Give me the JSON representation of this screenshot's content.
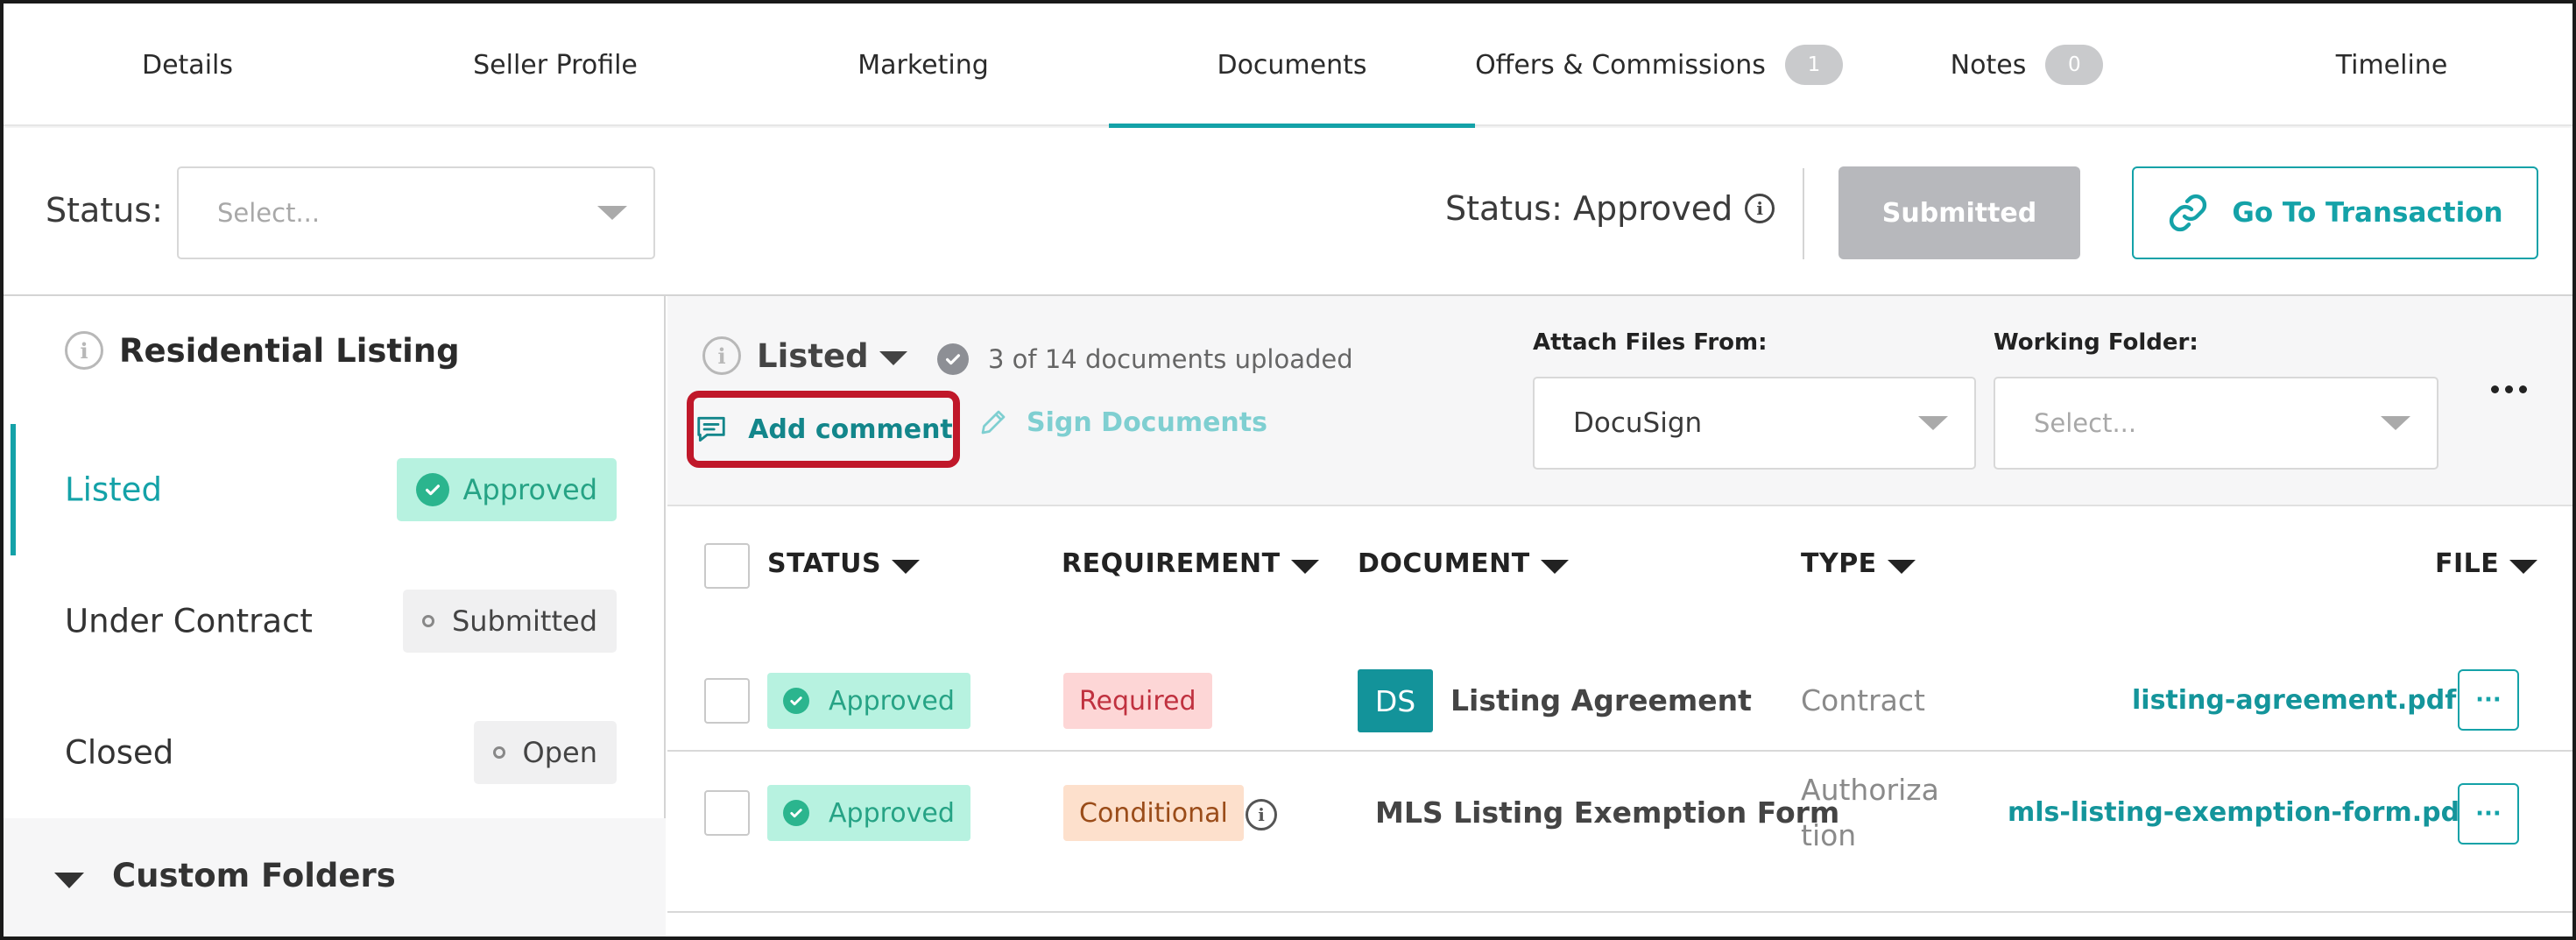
{
  "tabs": [
    {
      "label": "Details"
    },
    {
      "label": "Seller Profile"
    },
    {
      "label": "Marketing"
    },
    {
      "label": "Documents",
      "active": true
    },
    {
      "label": "Offers & Commissions",
      "count": "1"
    },
    {
      "label": "Notes",
      "count": "0"
    },
    {
      "label": "Timeline"
    }
  ],
  "status_bar": {
    "label": "Status:",
    "select_placeholder": "Select...",
    "current_status": "Status: Approved",
    "submitted_label": "Submitted",
    "goto_label": "Go To Transaction"
  },
  "sidebar": {
    "title": "Residential Listing",
    "items": [
      {
        "name": "Listed",
        "status": "Approved"
      },
      {
        "name": "Under Contract",
        "status": "Submitted"
      },
      {
        "name": "Closed",
        "status": "Open"
      }
    ],
    "custom_folders_label": "Custom Folders"
  },
  "toolbar": {
    "stage_label": "Listed",
    "uploaded_text": "3 of 14 documents uploaded",
    "add_comment_label": "Add comment",
    "sign_documents_label": "Sign Documents",
    "attach_files_label": "Attach Files From:",
    "attach_files_value": "DocuSign",
    "working_folder_label": "Working Folder:",
    "working_folder_placeholder": "Select..."
  },
  "table": {
    "headers": {
      "status": "STATUS",
      "requirement": "REQUIREMENT",
      "document": "DOCUMENT",
      "type": "TYPE",
      "file": "FILE"
    },
    "rows": [
      {
        "status": "Approved",
        "requirement": "Required",
        "doc_badge": "DS",
        "document": "Listing Agreement",
        "type": "Contract",
        "file": "listing-agreement.pdf",
        "action": "···"
      },
      {
        "status": "Approved",
        "requirement": "Conditional",
        "document": "MLS Listing Exemption Form",
        "type_line1": "Authoriza",
        "type_line2": "tion",
        "file": "mls-listing-exemption-form.pdf",
        "action": "···"
      }
    ]
  },
  "colors": {
    "accent": "#14a2a8",
    "approved_bg": "#b7f2e0",
    "highlight_box": "#c0182a"
  }
}
